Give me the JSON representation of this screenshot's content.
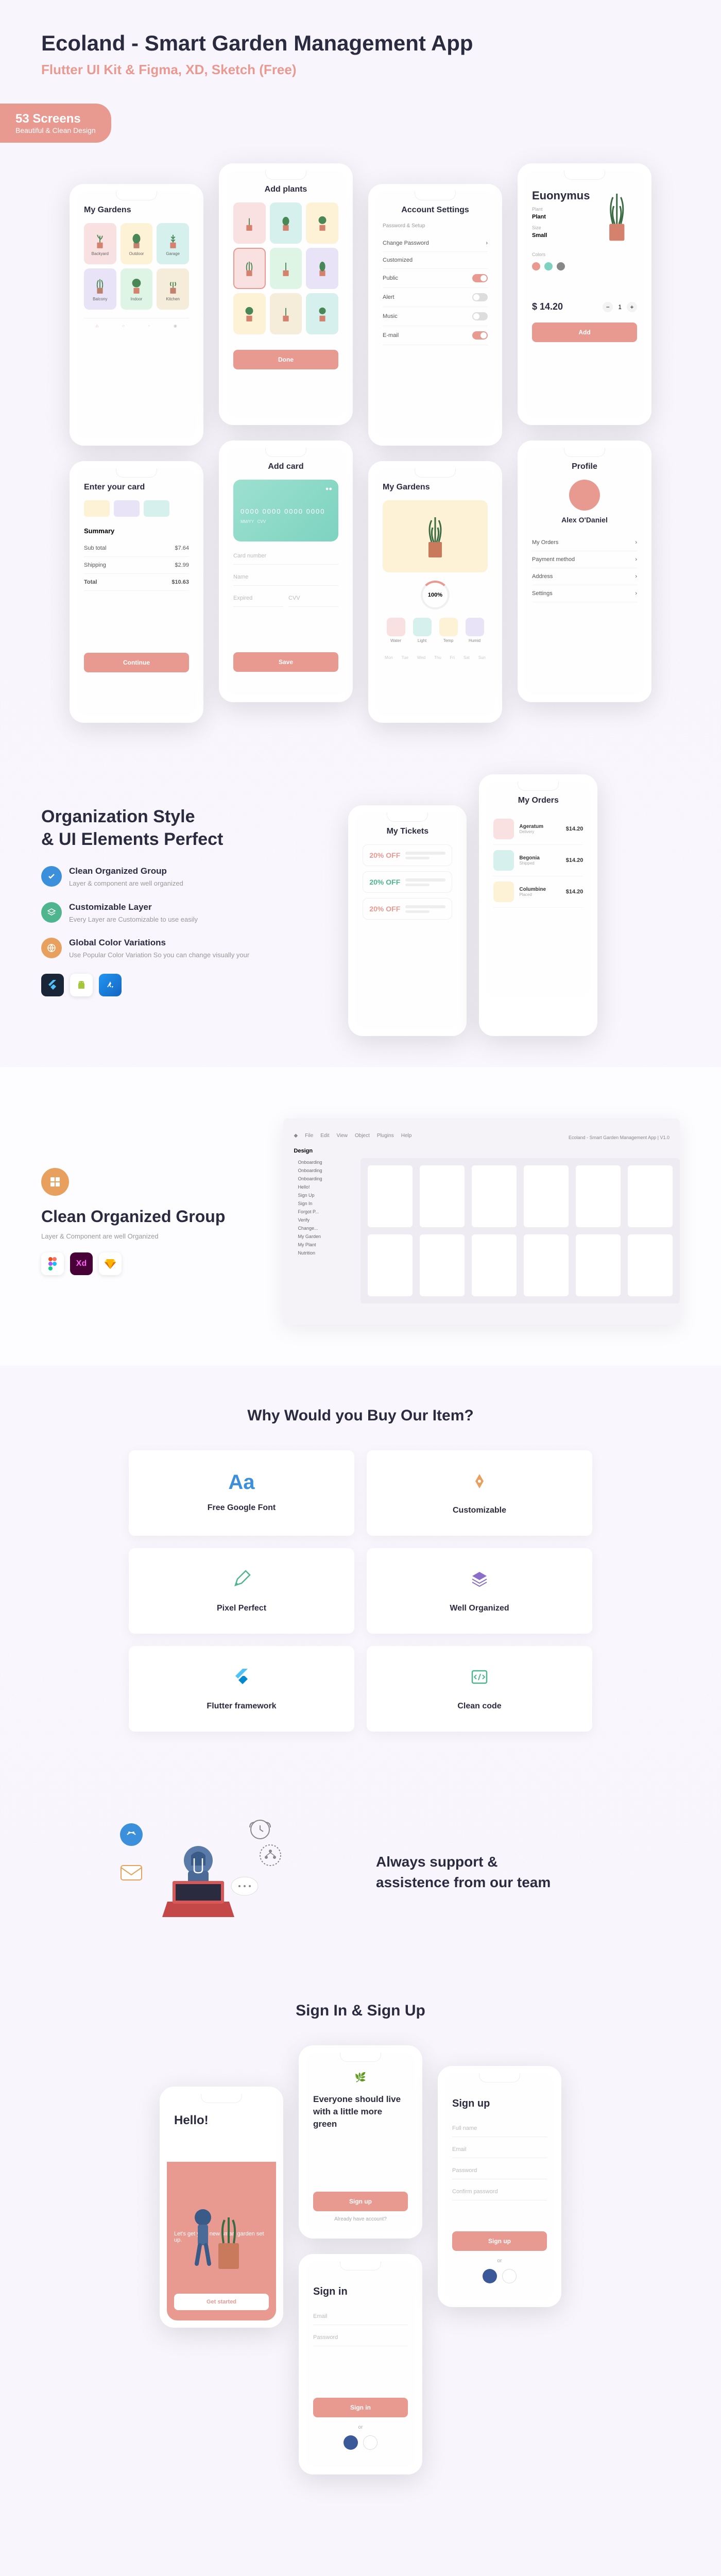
{
  "hero": {
    "title": "Ecoland - Smart Garden Management App",
    "subtitle": "Flutter UI Kit & Figma, XD, Sketch (Free)"
  },
  "badge": {
    "title": "53 Screens",
    "sub": "Beautiful & Clean Design"
  },
  "phones": {
    "gardens_title": "My Gardens",
    "add_plants_title": "Add plants",
    "settings_title": "Account Settings",
    "settings_sub": "Password & Setup",
    "product_name": "Euonymus",
    "product_type": "Plant",
    "product_size": "Size",
    "product_colors": "Colors",
    "product_price": "$ 14.20",
    "profile_title": "Profile",
    "profile_name": "Alex O'Daniel",
    "add_card_title": "Add card",
    "card_number": "0000  0000  0000  0000",
    "nutrition_percent": "100%",
    "enter_card_title": "Enter your card",
    "summary": "Summary",
    "subtotal": "Sub total",
    "shipping": "Shipping",
    "total": "Total",
    "subtotal_val": "$7.64",
    "shipping_val": "$2.99",
    "total_val": "$10.63",
    "settings_items": [
      "Change Password",
      "Customized"
    ],
    "settings_toggles": [
      "Public",
      "Alert",
      "Music",
      "E-mail"
    ],
    "profile_items": [
      "My Orders",
      "Payment method",
      "Address",
      "Settings"
    ],
    "gardens": [
      "Backyard",
      "Outdoor",
      "Garage",
      "Balcony",
      "Indoor",
      "Kitchen"
    ]
  },
  "org": {
    "title_l1": "Organization Style",
    "title_l2": "& UI Elements Perfect",
    "features": [
      {
        "title": "Clean Organized Group",
        "desc": "Layer & component are well organized"
      },
      {
        "title": "Customizable Layer",
        "desc": "Every Layer are Customizable to use easily"
      },
      {
        "title": "Global Color Variations",
        "desc": "Use Popular Color Variation So you can change visually your"
      }
    ],
    "tickets_title": "My Tickets",
    "discounts": [
      "20% OFF",
      "20% OFF",
      "20% OFF"
    ],
    "orders_title": "My Orders",
    "order_items": [
      {
        "name": "Ageratum",
        "meta": "Delivery",
        "price": "$14.20"
      },
      {
        "name": "Begonia",
        "meta": "Shipped",
        "price": "$14.20"
      },
      {
        "name": "Columbine",
        "meta": "Placed",
        "price": "$14.20"
      }
    ]
  },
  "figma": {
    "title": "Clean Organized Group",
    "desc": "Layer & Component are well Organized",
    "menu": [
      "File",
      "Edit",
      "View",
      "Object",
      "Plugins",
      "Help"
    ],
    "design_label": "Design",
    "file_label": "Ecoland - Smart Garden Management App | V1.0",
    "layers": [
      "Onboarding",
      "Onboarding",
      "Onboarding",
      "Hello!",
      "Sign Up",
      "Sign In",
      "Forgot P...",
      "Verify",
      "Change...",
      "My Garden",
      "My Plant",
      "Nutrition"
    ]
  },
  "why": {
    "title": "Why Would you Buy Our Item?",
    "cards": [
      "Free Google Font",
      "Customizable",
      "Pixel Perfect",
      "Well Organized",
      "Flutter framework",
      "Clean code"
    ]
  },
  "support": {
    "text_l1": "Always support &",
    "text_l2": "assistence from our team"
  },
  "signin": {
    "title": "Sign In & Sign Up",
    "hello": "Hello!",
    "hello_sub": "Let's get your new smart garden set up.",
    "onboard_title": "Everyone should live with a little more green",
    "signin_label": "Sign in",
    "signup_label": "Sign up",
    "signup_btn": "Sign up",
    "email_ph": "Email",
    "password_ph": "Password",
    "name_ph": "Full name",
    "confirm_ph": "Confirm password"
  }
}
